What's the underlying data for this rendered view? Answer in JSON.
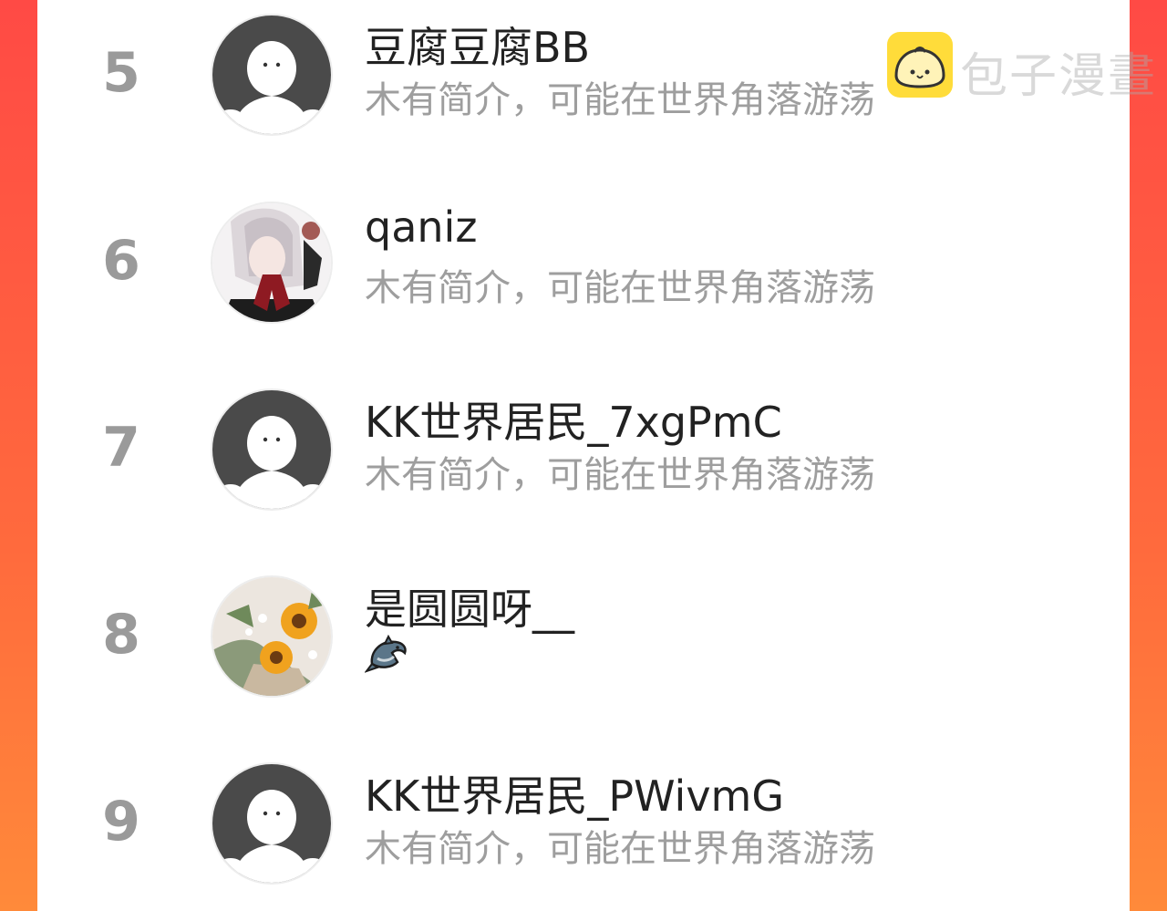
{
  "rows": [
    {
      "rank": "5",
      "name": "豆腐豆腐BB",
      "bio": "木有简介，可能在世界角落游荡",
      "avatar": "default-avatar"
    },
    {
      "rank": "6",
      "name": "qaniz",
      "bio": "木有简介，可能在世界角落游荡",
      "avatar": "anime-girl-avatar"
    },
    {
      "rank": "7",
      "name": "KK世界居民_7xgPmC",
      "bio": "木有简介，可能在世界角落游荡",
      "avatar": "default-avatar"
    },
    {
      "rank": "8",
      "name": "是圆圆呀__",
      "bio": "",
      "bio_icon": "dolphin-icon",
      "avatar": "sunflower-bouquet-avatar"
    },
    {
      "rank": "9",
      "name": "KK世界居民_PWivmG",
      "bio": "木有简介，可能在世界角落游荡",
      "avatar": "default-avatar"
    }
  ],
  "watermark": {
    "text": "包子漫畫",
    "icon": "bun-logo-icon"
  },
  "colors": {
    "accent_left": "#ff4a45",
    "accent_right": "#ff8a3a",
    "rank": "#9a9a9a",
    "bio": "#9e9e9e"
  }
}
